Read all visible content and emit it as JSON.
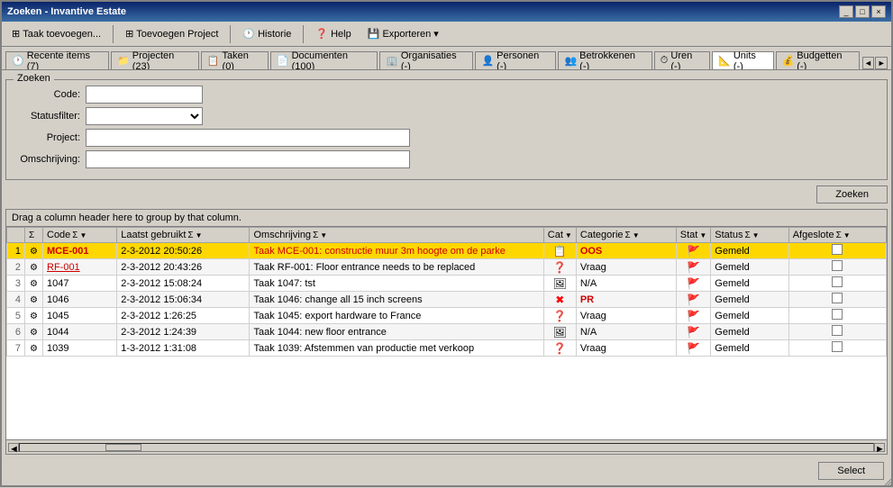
{
  "window": {
    "title": "Zoeken - Invantive Estate",
    "controls": [
      "_",
      "□",
      "×"
    ]
  },
  "toolbar": {
    "buttons": [
      {
        "id": "add-task",
        "label": "Taak toevoegen...",
        "icon": "⊞"
      },
      {
        "id": "add-project",
        "label": "Toevoegen Project",
        "icon": "⊞"
      },
      {
        "id": "history",
        "label": "Historie",
        "icon": "🕐"
      },
      {
        "id": "help",
        "label": "Help",
        "icon": "❓"
      },
      {
        "id": "export",
        "label": "Exporteren ▾",
        "icon": "💾"
      }
    ]
  },
  "tabs": [
    {
      "id": "recent",
      "label": "Recente items (7)",
      "icon": "🕐",
      "active": false
    },
    {
      "id": "projects",
      "label": "Projecten (23)",
      "icon": "📁",
      "active": false
    },
    {
      "id": "tasks",
      "label": "Taken (0)",
      "icon": "📋",
      "active": false
    },
    {
      "id": "documents",
      "label": "Documenten (100)",
      "icon": "📄",
      "active": false
    },
    {
      "id": "organisations",
      "label": "Organisaties (-)",
      "icon": "🏢",
      "active": false
    },
    {
      "id": "persons",
      "label": "Personen (-)",
      "icon": "👤",
      "active": false
    },
    {
      "id": "involved",
      "label": "Betrokkenen (-)",
      "icon": "👥",
      "active": false
    },
    {
      "id": "hours",
      "label": "Uren (-)",
      "icon": "⏱",
      "active": false
    },
    {
      "id": "units",
      "label": "Units (-)",
      "icon": "📐",
      "active": true
    },
    {
      "id": "budgets",
      "label": "Budgetten (-)",
      "icon": "💰",
      "active": false
    }
  ],
  "search": {
    "title": "Zoeken",
    "fields": {
      "code": {
        "label": "Code:",
        "value": "",
        "placeholder": ""
      },
      "statusfilter": {
        "label": "Statusfilter:",
        "value": "",
        "placeholder": ""
      },
      "project": {
        "label": "Project:",
        "value": "",
        "placeholder": ""
      },
      "omschrijving": {
        "label": "Omschrijving:",
        "value": "",
        "placeholder": ""
      }
    },
    "search_button": "Zoeken"
  },
  "grid": {
    "hint": "Drag a column header here to group by that column.",
    "columns": [
      {
        "id": "num",
        "label": ""
      },
      {
        "id": "icon",
        "label": ""
      },
      {
        "id": "code",
        "label": "Code"
      },
      {
        "id": "last_used",
        "label": "Laatst gebruikt"
      },
      {
        "id": "description",
        "label": "Omschrijving"
      },
      {
        "id": "cat_icon",
        "label": "Cat"
      },
      {
        "id": "category",
        "label": "Categorie"
      },
      {
        "id": "stat_icon",
        "label": "Stat"
      },
      {
        "id": "status",
        "label": "Status"
      },
      {
        "id": "closed",
        "label": "Afgeslote"
      }
    ],
    "rows": [
      {
        "num": 1,
        "code": "MCE-001",
        "last_used": "2-3-2012 20:50:26",
        "description": "Taak MCE-001: constructie muur 3m hoogte om de parke",
        "cat": "sheet",
        "category": "OOS",
        "stat": "flag",
        "status": "Gemeld",
        "closed": false,
        "selected": true
      },
      {
        "num": 2,
        "code": "RF-001",
        "last_used": "2-3-2012 20:43:26",
        "description": "Taak RF-001: Floor entrance needs to be replaced",
        "cat": "question",
        "category": "Vraag",
        "stat": "flag",
        "status": "Gemeld",
        "closed": false,
        "selected": false
      },
      {
        "num": 3,
        "code": "1047",
        "last_used": "2-3-2012 15:08:24",
        "description": "Taak 1047: tst",
        "cat": "image",
        "category": "N/A",
        "stat": "flag",
        "status": "Gemeld",
        "closed": false,
        "selected": false
      },
      {
        "num": 4,
        "code": "1046",
        "last_used": "2-3-2012 15:06:34",
        "description": "Taak 1046: change all 15 inch screens",
        "cat": "cross",
        "category": "PR",
        "stat": "flag",
        "status": "Gemeld",
        "closed": false,
        "selected": false
      },
      {
        "num": 5,
        "code": "1045",
        "last_used": "2-3-2012 1:26:25",
        "description": "Taak 1045: export hardware to France",
        "cat": "question",
        "category": "Vraag",
        "stat": "flag",
        "status": "Gemeld",
        "closed": false,
        "selected": false
      },
      {
        "num": 6,
        "code": "1044",
        "last_used": "2-3-2012 1:24:39",
        "description": "Taak 1044: new floor entrance",
        "cat": "image",
        "category": "N/A",
        "stat": "flag",
        "status": "Gemeld",
        "closed": false,
        "selected": false
      },
      {
        "num": 7,
        "code": "1039",
        "last_used": "1-3-2012 1:31:08",
        "description": "Taak 1039: Afstemmen van productie met verkoop",
        "cat": "question",
        "category": "Vraag",
        "stat": "flag",
        "status": "Gemeld",
        "closed": false,
        "selected": false
      }
    ]
  },
  "footer": {
    "select_button": "Select"
  }
}
